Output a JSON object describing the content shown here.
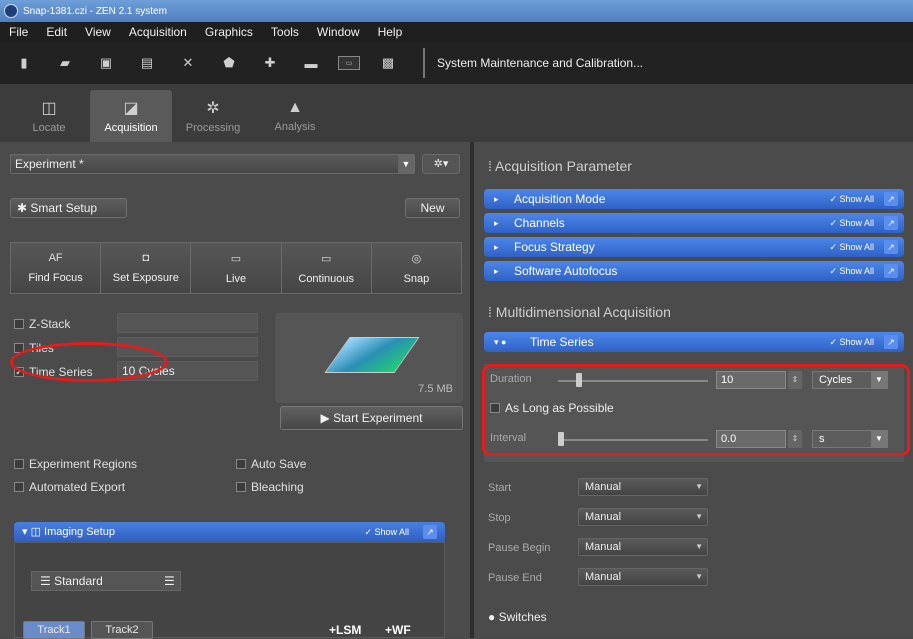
{
  "window": {
    "title": "Snap-1381.czi - ZEN 2.1 system"
  },
  "menu": [
    "File",
    "Edit",
    "View",
    "Acquisition",
    "Graphics",
    "Tools",
    "Window",
    "Help"
  ],
  "toolbar": {
    "system_maintenance": "System Maintenance and Calibration..."
  },
  "mode_tabs": [
    {
      "label": "Locate"
    },
    {
      "label": "Acquisition"
    },
    {
      "label": "Processing"
    },
    {
      "label": "Analysis"
    }
  ],
  "left": {
    "experiment_select": "Experiment *",
    "smart_setup": "Smart Setup",
    "new_button": "New",
    "actions": [
      {
        "icon_text": "AF",
        "label": "Find Focus"
      },
      {
        "icon_text": "◘",
        "label": "Set Exposure"
      },
      {
        "icon_text": "▭",
        "label": "Live"
      },
      {
        "icon_text": "▭",
        "label": "Continuous"
      },
      {
        "icon_text": "◎",
        "label": "Snap"
      }
    ],
    "options": [
      {
        "label": "Z-Stack",
        "checked": false
      },
      {
        "label": "Tiles",
        "checked": false
      },
      {
        "label": "Time Series",
        "checked": true,
        "value": "10 Cycles"
      }
    ],
    "size_label": "7.5 MB",
    "start_experiment": "Start Experiment",
    "extra_options": {
      "experiment_regions": "Experiment Regions",
      "auto_save": "Auto Save",
      "automated_export": "Automated Export",
      "bleaching": "Bleaching"
    },
    "imaging_setup": {
      "title": "Imaging Setup",
      "show_all": "✓ Show All",
      "standard": "Standard",
      "tracks": [
        "Track1",
        "Track2"
      ],
      "add_lsm": "+LSM",
      "add_wf": "+WF"
    }
  },
  "right": {
    "acq_param_title": "Acquisition Parameter",
    "acq_rows": [
      {
        "label": "Acquisition Mode",
        "show_all": "✓ Show All"
      },
      {
        "label": "Channels",
        "show_all": "✓ Show All"
      },
      {
        "label": "Focus Strategy",
        "show_all": "✓ Show All"
      },
      {
        "label": "Software Autofocus",
        "show_all": "✓ Show All"
      }
    ],
    "multi_title": "Multidimensional Acquisition",
    "time_series": {
      "title": "Time Series",
      "show_all": "✓ Show All",
      "duration_label": "Duration",
      "duration_value": "10",
      "duration_unit": "Cycles",
      "as_long_as_possible": "As Long as Possible",
      "interval_label": "Interval",
      "interval_value": "0.0",
      "interval_unit": "s"
    },
    "controls": [
      {
        "label": "Start",
        "value": "Manual"
      },
      {
        "label": "Stop",
        "value": "Manual"
      },
      {
        "label": "Pause Begin",
        "value": "Manual"
      },
      {
        "label": "Pause End",
        "value": "Manual"
      }
    ],
    "switches": "Switches"
  },
  "colors": {
    "highlight": "#e51c1c",
    "section_blue": "#2f62c6"
  }
}
